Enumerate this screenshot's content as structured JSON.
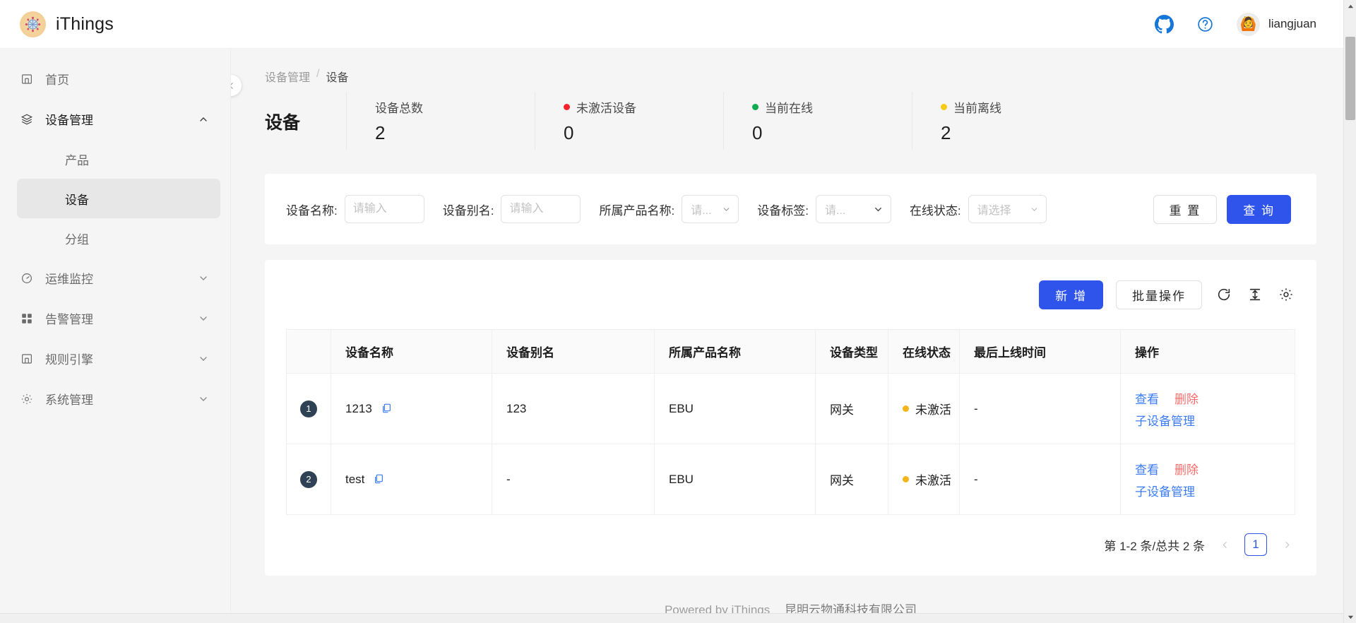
{
  "app": {
    "brand": "iThings",
    "user": "liangjuan",
    "logo_icon": "network-nodes-icon",
    "github_icon": "github-icon",
    "help_icon": "question-circle-icon",
    "avatar_icon": "user-avatar-icon"
  },
  "sidebar": {
    "collapse_icon": "chevron-left-icon",
    "items": [
      {
        "label": "首页",
        "icon": "home-icon",
        "expandable": false,
        "active": false
      },
      {
        "label": "设备管理",
        "icon": "layers-icon",
        "expandable": true,
        "expanded": true,
        "active": true,
        "children": [
          {
            "label": "产品",
            "selected": false
          },
          {
            "label": "设备",
            "selected": true
          },
          {
            "label": "分组",
            "selected": false
          }
        ]
      },
      {
        "label": "运维监控",
        "icon": "gauge-icon",
        "expandable": true,
        "expanded": false,
        "active": false
      },
      {
        "label": "告警管理",
        "icon": "grid-icon",
        "expandable": true,
        "expanded": false,
        "active": false
      },
      {
        "label": "规则引擎",
        "icon": "rules-icon",
        "expandable": true,
        "expanded": false,
        "active": false
      },
      {
        "label": "系统管理",
        "icon": "gear-icon",
        "expandable": true,
        "expanded": false,
        "active": false
      }
    ]
  },
  "breadcrumb": {
    "parent": "设备管理",
    "separator": "/",
    "current": "设备"
  },
  "page": {
    "title": "设备"
  },
  "stats": [
    {
      "label": "设备总数",
      "value": "2",
      "dot": null
    },
    {
      "label": "未激活设备",
      "value": "0",
      "dot": "#f5222d"
    },
    {
      "label": "当前在线",
      "value": "0",
      "dot": "#0bab4e"
    },
    {
      "label": "当前离线",
      "value": "2",
      "dot": "#f5cb14"
    }
  ],
  "filters": {
    "device_name": {
      "label": "设备名称:",
      "value": "",
      "placeholder": "请输入"
    },
    "device_alias": {
      "label": "设备别名:",
      "value": "",
      "placeholder": "请输入"
    },
    "product_name": {
      "label": "所属产品名称:",
      "value": "请...",
      "type": "select"
    },
    "device_tag": {
      "label": "设备标签:",
      "value": "请...",
      "type": "select"
    },
    "online_status": {
      "label": "在线状态:",
      "value": "请选择",
      "type": "select"
    },
    "reset_label": "重 置",
    "query_label": "查 询"
  },
  "toolbar": {
    "add_label": "新 增",
    "batch_label": "批量操作",
    "refresh_icon": "refresh-icon",
    "density_icon": "density-icon",
    "settings_icon": "gear-icon"
  },
  "table": {
    "columns": [
      "",
      "设备名称",
      "设备别名",
      "所属产品名称",
      "设备类型",
      "在线状态",
      "最后上线时间",
      "操作"
    ],
    "rows": [
      {
        "index": "1",
        "device_name": "1213",
        "alias": "123",
        "product": "EBU",
        "type": "网关",
        "status": "未激活",
        "status_dot": "#f5b518",
        "last_online": "-",
        "actions": [
          "查看",
          "删除",
          "子设备管理"
        ]
      },
      {
        "index": "2",
        "device_name": "test",
        "alias": "-",
        "product": "EBU",
        "type": "网关",
        "status": "未激活",
        "status_dot": "#f5b518",
        "last_online": "-",
        "actions": [
          "查看",
          "删除",
          "子设备管理"
        ]
      }
    ],
    "copy_icon": "copy-icon"
  },
  "pagination": {
    "summary": "第 1-2 条/总共 2 条",
    "prev_icon": "chevron-left-icon",
    "next_icon": "chevron-right-icon",
    "current_page": "1"
  },
  "footer": {
    "powered": "Powered by iThings",
    "company": "昆明云物通科技有限公司"
  },
  "colors": {
    "primary": "#2f54eb",
    "link": "#3b7cf5",
    "danger": "#ff6b6b"
  }
}
